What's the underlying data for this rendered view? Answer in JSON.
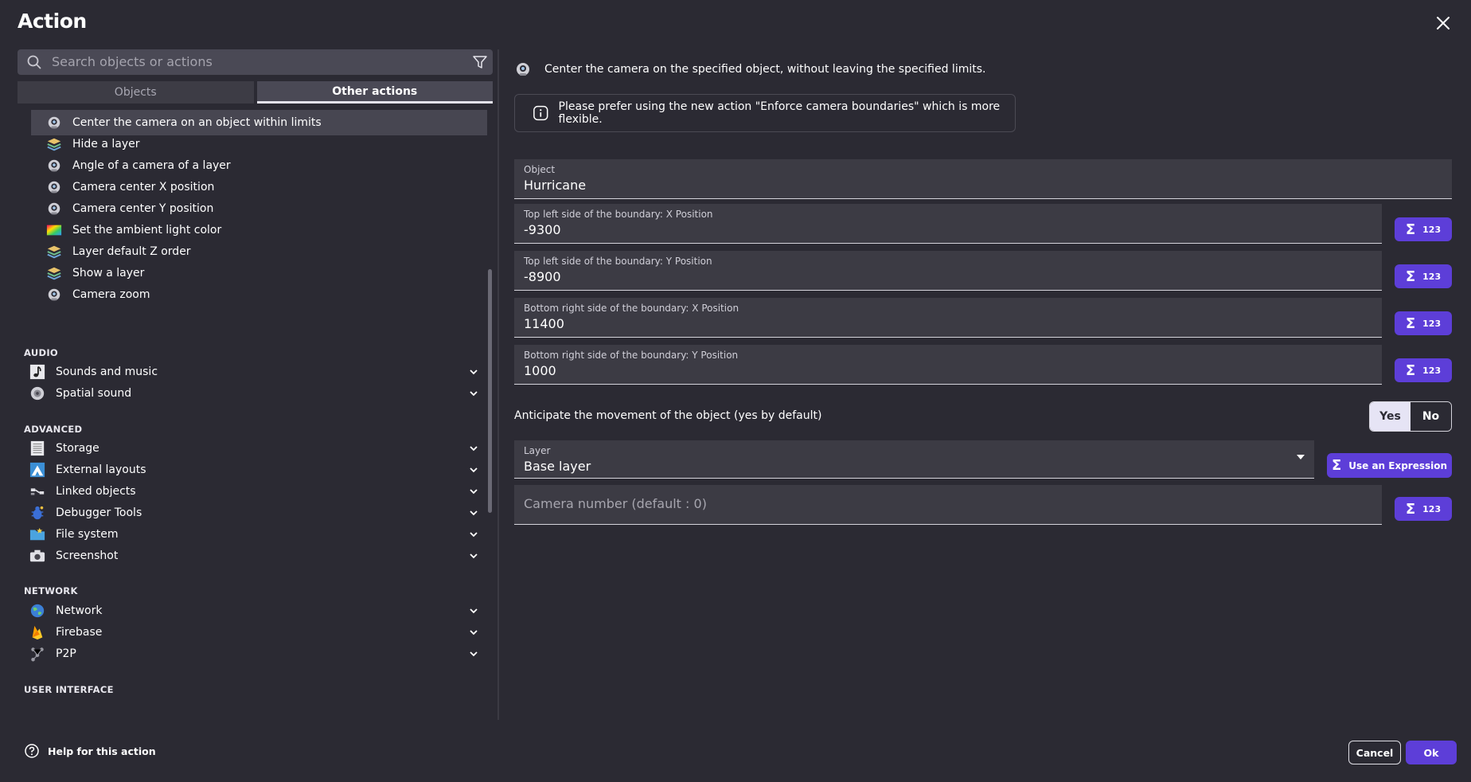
{
  "title": "Action",
  "search": {
    "placeholder": "Search objects or actions"
  },
  "tabs": [
    {
      "label": "Objects",
      "active": false
    },
    {
      "label": "Other actions",
      "active": true
    }
  ],
  "actions": [
    {
      "label": "Center the camera on an object within limits",
      "icon": "camera-icon",
      "selected": true
    },
    {
      "label": "Hide a layer",
      "icon": "layer-icon"
    },
    {
      "label": "Angle of a camera of a layer",
      "icon": "camera-icon"
    },
    {
      "label": "Camera center X position",
      "icon": "camera-icon"
    },
    {
      "label": "Camera center Y position",
      "icon": "camera-icon"
    },
    {
      "label": "Set the ambient light color",
      "icon": "light-color-icon"
    },
    {
      "label": "Layer default Z order",
      "icon": "layer-icon"
    },
    {
      "label": "Show a layer",
      "icon": "layer-icon"
    },
    {
      "label": "Camera zoom",
      "icon": "camera-icon"
    }
  ],
  "sections": {
    "audio": "AUDIO",
    "advanced": "ADVANCED",
    "network": "NETWORK",
    "ui": "USER INTERFACE"
  },
  "categories": {
    "audio": [
      {
        "label": "Sounds and music",
        "icon": "music-note-icon"
      },
      {
        "label": "Spatial sound",
        "icon": "speaker-icon"
      }
    ],
    "advanced": [
      {
        "label": "Storage",
        "icon": "storage-icon"
      },
      {
        "label": "External layouts",
        "icon": "external-layout-icon"
      },
      {
        "label": "Linked objects",
        "icon": "link-icon"
      },
      {
        "label": "Debugger Tools",
        "icon": "bug-icon"
      },
      {
        "label": "File system",
        "icon": "folder-icon"
      },
      {
        "label": "Screenshot",
        "icon": "screenshot-icon"
      }
    ],
    "network": [
      {
        "label": "Network",
        "icon": "globe-icon"
      },
      {
        "label": "Firebase",
        "icon": "firebase-icon"
      },
      {
        "label": "P2P",
        "icon": "p2p-icon"
      }
    ]
  },
  "description": "Center the camera on the specified object, without leaving the specified limits.",
  "notice": "Please prefer using the new action \"Enforce camera boundaries\" which is more flexible.",
  "fields": {
    "object": {
      "label": "Object",
      "value": "Hurricane"
    },
    "top_left_x": {
      "label": "Top left side of the boundary: X Position",
      "value": "-9300"
    },
    "top_left_y": {
      "label": "Top left side of the boundary: Y Position",
      "value": "-8900"
    },
    "bottom_right_x": {
      "label": "Bottom right side of the boundary: X Position",
      "value": "11400"
    },
    "bottom_right_y": {
      "label": "Bottom right side of the boundary: Y Position",
      "value": "1000"
    },
    "anticipate": {
      "label": "Anticipate the movement of the object (yes by default)",
      "yes": "Yes",
      "no": "No",
      "selected": "Yes"
    },
    "layer": {
      "label": "Layer",
      "value": "Base layer"
    },
    "camera": {
      "placeholder": "Camera number (default : 0)"
    }
  },
  "expression_button": {
    "sigma": "Σ",
    "number": "123",
    "wide_label": "Use an Expression"
  },
  "footer": {
    "help": "Help for this action",
    "cancel": "Cancel",
    "ok": "Ok"
  },
  "colors": {
    "background": "#2b2a33",
    "accent": "#5d3ed8",
    "field": "#3c3b44"
  }
}
